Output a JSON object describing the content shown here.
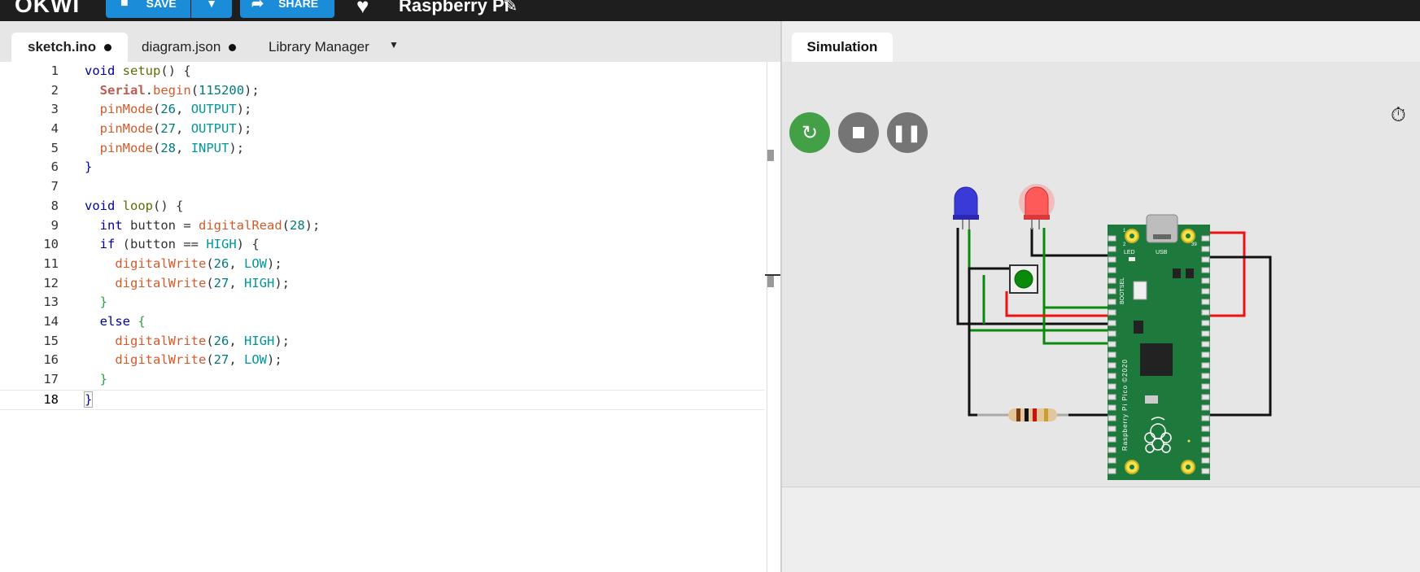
{
  "header": {
    "logo_text": "OKWI",
    "save_label": "SAVE",
    "share_label": "SHARE",
    "project_title": "Raspberry Pi"
  },
  "editor": {
    "tabs": [
      {
        "label": "sketch.ino",
        "modified": true
      },
      {
        "label": "diagram.json",
        "modified": true
      },
      {
        "label": "Library Manager",
        "modified": false
      }
    ],
    "lines": [
      {
        "n": "1"
      },
      {
        "n": "2"
      },
      {
        "n": "3"
      },
      {
        "n": "4"
      },
      {
        "n": "5"
      },
      {
        "n": "6"
      },
      {
        "n": "7"
      },
      {
        "n": "8"
      },
      {
        "n": "9"
      },
      {
        "n": "10"
      },
      {
        "n": "11"
      },
      {
        "n": "12"
      },
      {
        "n": "13"
      },
      {
        "n": "14"
      },
      {
        "n": "15"
      },
      {
        "n": "16"
      },
      {
        "n": "17"
      },
      {
        "n": "18"
      }
    ],
    "code": {
      "l1_a": "void",
      "l1_b": "setup",
      "l1_c": "() {",
      "l2_a": "Serial",
      "l2_b": ".",
      "l2_c": "begin",
      "l2_d": "(",
      "l2_e": "115200",
      "l2_f": ");",
      "l3_a": "pinMode",
      "l3_b": "(",
      "l3_c": "26",
      "l3_d": ", ",
      "l3_e": "OUTPUT",
      "l3_f": ");",
      "l4_a": "pinMode",
      "l4_b": "(",
      "l4_c": "27",
      "l4_d": ", ",
      "l4_e": "OUTPUT",
      "l4_f": ");",
      "l5_a": "pinMode",
      "l5_b": "(",
      "l5_c": "28",
      "l5_d": ", ",
      "l5_e": "INPUT",
      "l5_f": ");",
      "l6_a": "}",
      "l8_a": "void",
      "l8_b": "loop",
      "l8_c": "() {",
      "l9_a": "int",
      "l9_b": " button = ",
      "l9_c": "digitalRead",
      "l9_d": "(",
      "l9_e": "28",
      "l9_f": ");",
      "l10_a": "if",
      "l10_b": " (button == ",
      "l10_c": "HIGH",
      "l10_d": ") {",
      "l11_a": "digitalWrite",
      "l11_b": "(",
      "l11_c": "26",
      "l11_d": ", ",
      "l11_e": "LOW",
      "l11_f": ");",
      "l12_a": "digitalWrite",
      "l12_b": "(",
      "l12_c": "27",
      "l12_d": ", ",
      "l12_e": "HIGH",
      "l12_f": ");",
      "l13_a": "}",
      "l14_a": "else",
      "l14_b": " {",
      "l15_a": "digitalWrite",
      "l15_b": "(",
      "l15_c": "26",
      "l15_d": ", ",
      "l15_e": "HIGH",
      "l15_f": ");",
      "l16_a": "digitalWrite",
      "l16_b": "(",
      "l16_c": "27",
      "l16_d": ", ",
      "l16_e": "LOW",
      "l16_f": ");",
      "l17_a": "}",
      "l18_a": "}"
    }
  },
  "simulation": {
    "tab_label": "Simulation",
    "board_labels": {
      "led": "LED",
      "usb": "USB",
      "bootsel": "BOOTSEL",
      "name": "Raspberry Pi Pico ©2020",
      "pin1": "1",
      "pin2": "2",
      "pin39": "39"
    }
  },
  "colors": {
    "topbar": "#1e1e1e",
    "accent_blue": "#1a8cd8",
    "run_green": "#43a047",
    "ctrl_gray": "#757575",
    "board_green": "#1e7a3c",
    "led_blue": "#3a3ad8",
    "led_red": "#ff5a5a",
    "wire_red": "#e11",
    "wire_green": "#0a8a0a",
    "wire_black": "#111"
  },
  "icons": {
    "save": "floppy-disk-icon",
    "share": "share-arrow-icon",
    "favorite": "heart-icon",
    "edit": "pencil-icon",
    "restart": "restart-icon",
    "stop": "stop-icon",
    "pause": "pause-icon",
    "timer": "stopwatch-icon"
  }
}
